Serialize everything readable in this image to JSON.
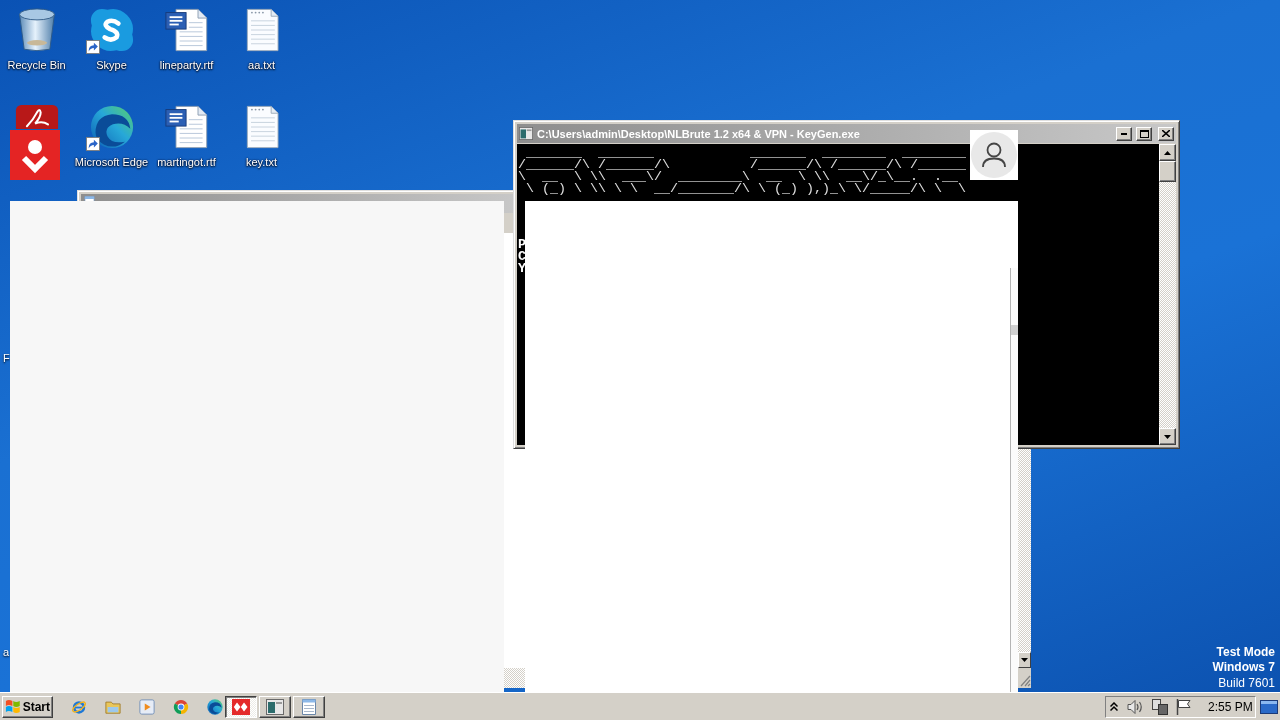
{
  "desktop": {
    "icons": [
      {
        "kind": "recycle-bin",
        "label": "Recycle Bin",
        "shortcut": false
      },
      {
        "kind": "skype",
        "label": "Skype",
        "shortcut": true
      },
      {
        "kind": "word-doc",
        "label": "lineparty.rtf",
        "shortcut": false
      },
      {
        "kind": "text-doc",
        "label": "aa.txt",
        "shortcut": false
      },
      {
        "kind": "pdf",
        "shortcut": false
      },
      {
        "kind": "edge",
        "label": "Microsoft Edge",
        "shortcut": true
      },
      {
        "kind": "word-doc",
        "label": "martingot.rtf",
        "shortcut": false
      },
      {
        "kind": "text-doc",
        "label": "key.txt",
        "shortcut": false
      }
    ],
    "covered_labels": [
      "F",
      "a"
    ],
    "build_info": {
      "mode": "Test Mode",
      "os": "Windows 7",
      "build": "Build 7601"
    }
  },
  "console_window": {
    "title": "C:\\Users\\admin\\Desktop\\NLBrute 1.2 x64 & VPN - KeyGen.exe",
    "art": [
      " _______  _______            _______  ________  ________",
      "/______/\\ /______/\\          /______/\\ /______/\\ /______",
      "\\  __  \\ \\\\  ___\\/  ________\\  __  \\ \\\\  __\\/_\\__.  .__",
      " \\ (_) \\ \\\\ \\ \\  __/_______/\\ \\ (_) ),)_\\ \\/_____/\\ \\  \\"
    ],
    "lines": [
      "P",
      "C",
      "Y"
    ]
  },
  "taskbar": {
    "start": "Start",
    "quick_launch": [
      {
        "kind": "ie"
      },
      {
        "kind": "folder"
      },
      {
        "kind": "media-player"
      },
      {
        "kind": "chrome"
      },
      {
        "kind": "edge"
      }
    ],
    "tasks": [
      {
        "kind": "red-app",
        "selected": true
      },
      {
        "kind": "console",
        "selected": false
      },
      {
        "kind": "notepad",
        "selected": false
      }
    ],
    "clock": "2:55 PM"
  }
}
